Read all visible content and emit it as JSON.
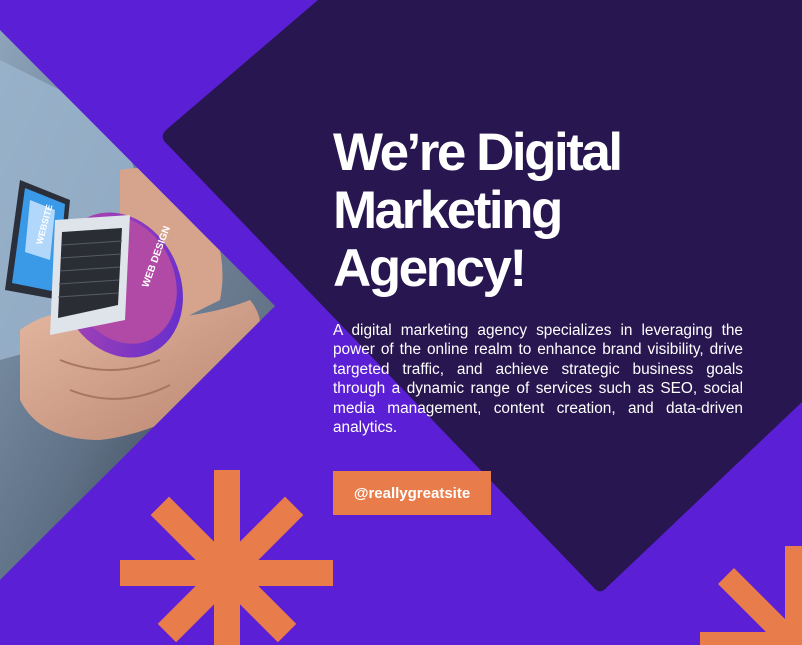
{
  "headline": {
    "line1": "We’re Digital",
    "line2": "Marketing",
    "line3": "Agency!"
  },
  "body_text": "A digital marketing agency specializes in leveraging the power of the online realm to enhance brand visibility, drive targeted traffic, and achieve strategic business goals through a dynamic range of services such as SEO, social media management, content creation, and data-driven analytics.",
  "cta": {
    "label": "@reallygreatsite"
  },
  "photo": {
    "screen_label": "WEBSITE",
    "badge_label": "WEB DESIGN"
  },
  "colors": {
    "background_purple": "#5b1fd6",
    "panel_dark": "#27164f",
    "accent_orange": "#e97c4b",
    "text": "#ffffff"
  },
  "icons": [
    "asterisk-icon",
    "arrow-icon"
  ]
}
